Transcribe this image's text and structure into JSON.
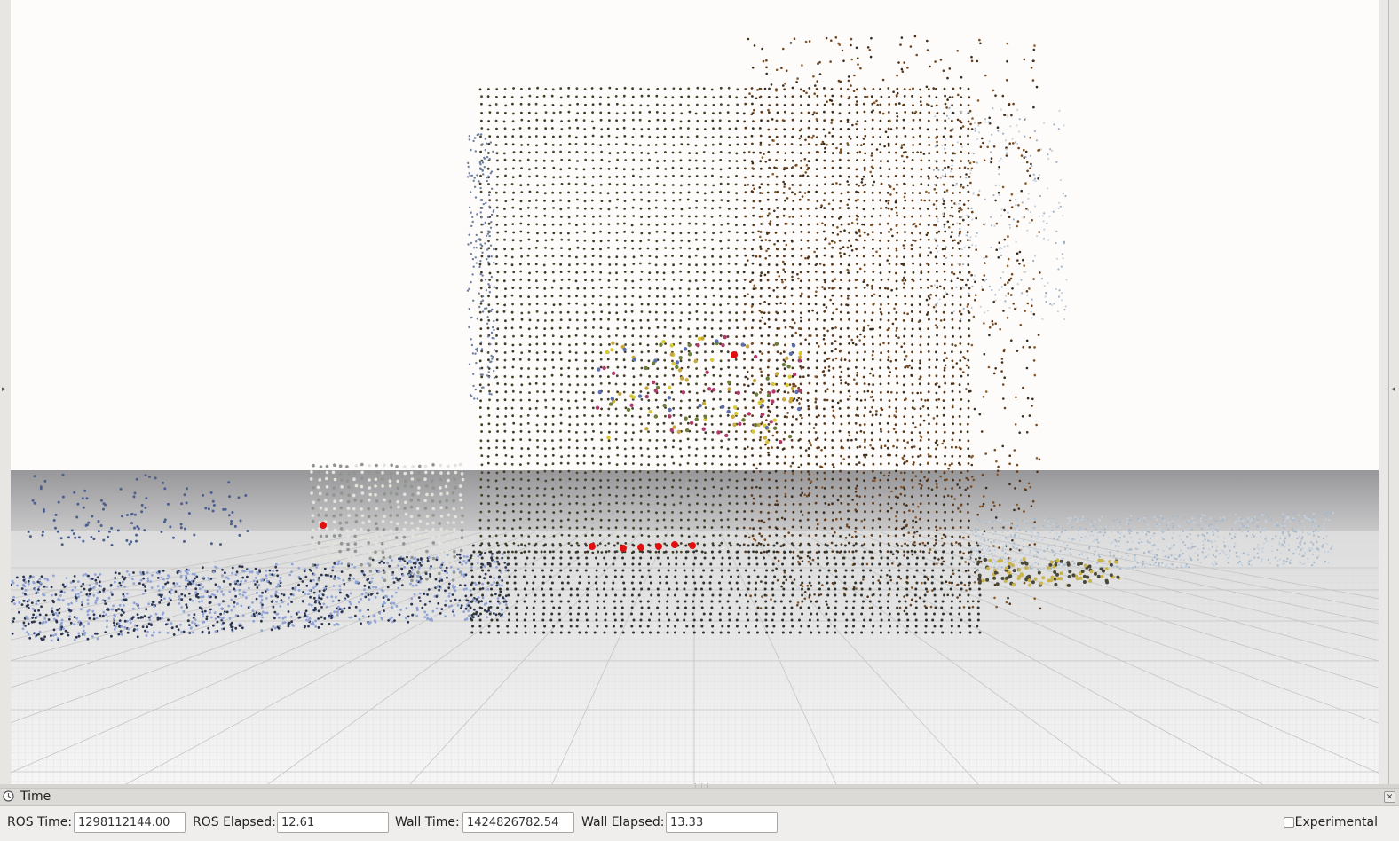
{
  "viewport": {
    "name": "3D point cloud view",
    "sky_color": "#fdfcfa",
    "ground_color": "#a9a9ab",
    "floor_color": "#f2f2f1"
  },
  "time_panel": {
    "title": "Time",
    "clock_icon": "clock-icon",
    "close_icon": "close-icon",
    "fields": {
      "ros_time_label": "ROS Time:",
      "ros_time_value": "1298112144.00",
      "ros_elapsed_label": "ROS Elapsed:",
      "ros_elapsed_value": "12.61",
      "wall_time_label": "Wall Time:",
      "wall_time_value": "1424826782.54",
      "wall_elapsed_label": "Wall Elapsed:",
      "wall_elapsed_value": "13.33"
    },
    "experimental_label": "Experimental",
    "experimental_checked": false
  }
}
